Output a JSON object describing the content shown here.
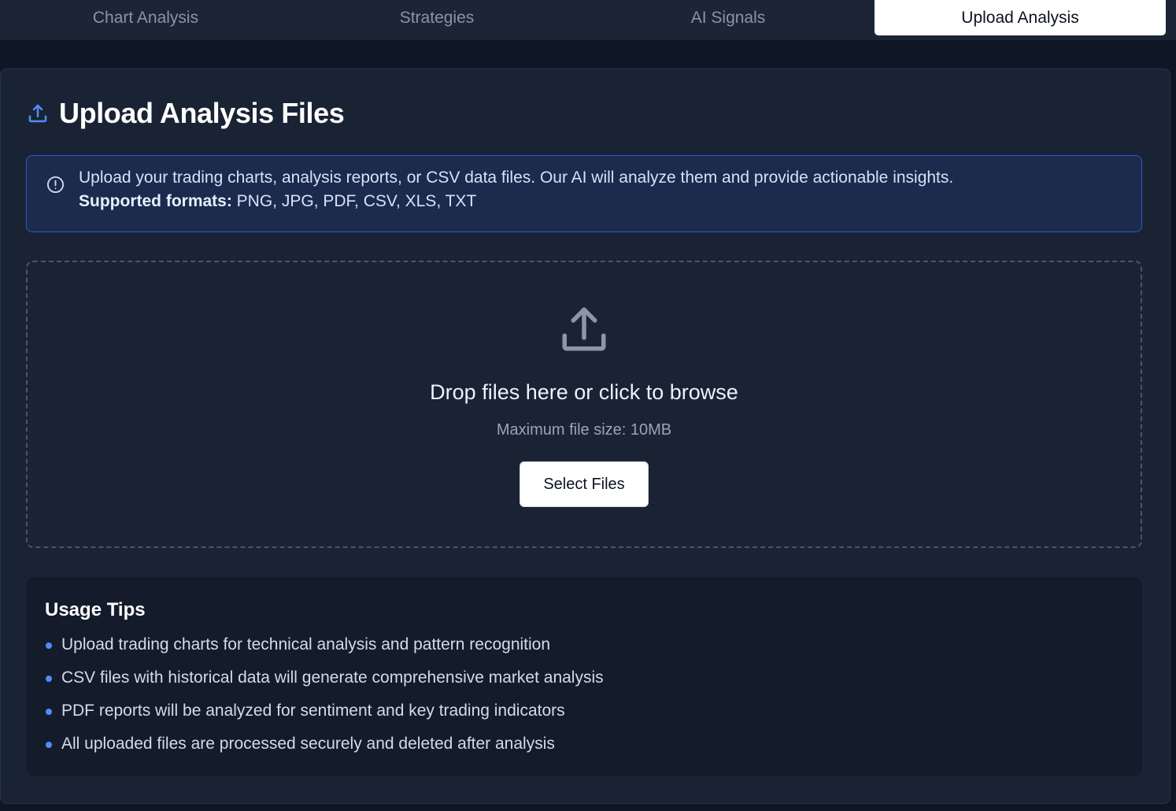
{
  "tabs": [
    {
      "label": "Chart Analysis",
      "active": false
    },
    {
      "label": "Strategies",
      "active": false
    },
    {
      "label": "AI Signals",
      "active": false
    },
    {
      "label": "Upload Analysis",
      "active": true
    }
  ],
  "page": {
    "title": "Upload Analysis Files",
    "title_icon": "upload-icon"
  },
  "alert": {
    "icon": "info-circle-icon",
    "message": "Upload your trading charts, analysis reports, or CSV data files. Our AI will analyze them and provide actionable insights.",
    "formats_label": "Supported formats:",
    "formats_value": " PNG, JPG, PDF, CSV, XLS, TXT"
  },
  "dropzone": {
    "icon": "upload-icon",
    "title": "Drop files here or click to browse",
    "subtitle": "Maximum file size: 10MB",
    "button_label": "Select Files"
  },
  "tips": {
    "title": "Usage Tips",
    "items": [
      "Upload trading charts for technical analysis and pattern recognition",
      "CSV files with historical data will generate comprehensive market analysis",
      "PDF reports will be analyzed for sentiment and key trading indicators",
      "All uploaded files are processed securely and deleted after analysis"
    ]
  },
  "colors": {
    "accent_blue": "#4f8ef7",
    "background": "#0f1726",
    "card": "#1a2334",
    "alert_border": "#2e59c7"
  }
}
